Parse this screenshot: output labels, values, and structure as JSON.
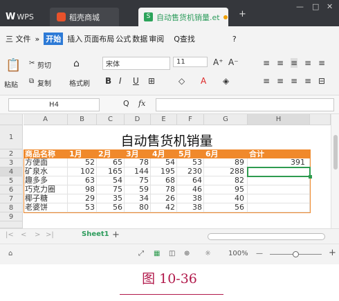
{
  "titlebar": {
    "wps_label": "WPS",
    "tab_store": "稻壳商城",
    "tab_file": "自动售货机销量.et",
    "add_tab": "+",
    "win_min": "—",
    "win_max": "□",
    "win_close": "✕"
  },
  "menu": {
    "file": "三 文件",
    "more": "»",
    "start": "开始",
    "items": [
      "插入",
      "页面布局",
      "公式",
      "数据",
      "审阅"
    ],
    "search": "Q查找",
    "help": "?"
  },
  "ribbon": {
    "paste": "粘贴",
    "cut": "剪切",
    "copy": "复制",
    "format_painter": "格式刷",
    "font_name": "宋体",
    "font_size": "11",
    "bold": "B",
    "italic": "I",
    "underline": "U",
    "grow": "A⁺",
    "shrink": "A⁻"
  },
  "formula_bar": {
    "cell_ref": "H4",
    "fx": "fx",
    "zoom_icon": "Q"
  },
  "columns": [
    "A",
    "B",
    "C",
    "D",
    "E",
    "F",
    "G",
    "H"
  ],
  "rows": [
    "1",
    "2",
    "3",
    "4",
    "5",
    "6",
    "7",
    "8",
    "9"
  ],
  "sheet": {
    "title": "自动售货机销量",
    "headers": [
      "商品名称",
      "1月",
      "2月",
      "3月",
      "4月",
      "5月",
      "6月",
      "合计"
    ],
    "data": [
      {
        "name": "方便面",
        "values": [
          "52",
          "65",
          "78",
          "54",
          "53",
          "89"
        ],
        "total": "391"
      },
      {
        "name": "矿泉水",
        "values": [
          "102",
          "165",
          "144",
          "195",
          "230",
          "288"
        ],
        "total": ""
      },
      {
        "name": "趣多多",
        "values": [
          "63",
          "54",
          "75",
          "68",
          "64",
          "82"
        ],
        "total": ""
      },
      {
        "name": "巧克力圈",
        "values": [
          "98",
          "75",
          "59",
          "78",
          "46",
          "95"
        ],
        "total": ""
      },
      {
        "name": "椰子糖",
        "values": [
          "29",
          "35",
          "34",
          "26",
          "38",
          "40"
        ],
        "total": ""
      },
      {
        "name": "老婆饼",
        "values": [
          "53",
          "56",
          "80",
          "42",
          "38",
          "56"
        ],
        "total": ""
      }
    ]
  },
  "sheet_tabs": {
    "active": "Sheet1",
    "add": "+"
  },
  "status": {
    "zoom": "100%",
    "minus": "—",
    "plus": "+"
  },
  "caption": "图  10-36",
  "colors": {
    "header_fill": "#f0892b",
    "selection": "#2e9b4f",
    "caption": "#b1184a"
  }
}
